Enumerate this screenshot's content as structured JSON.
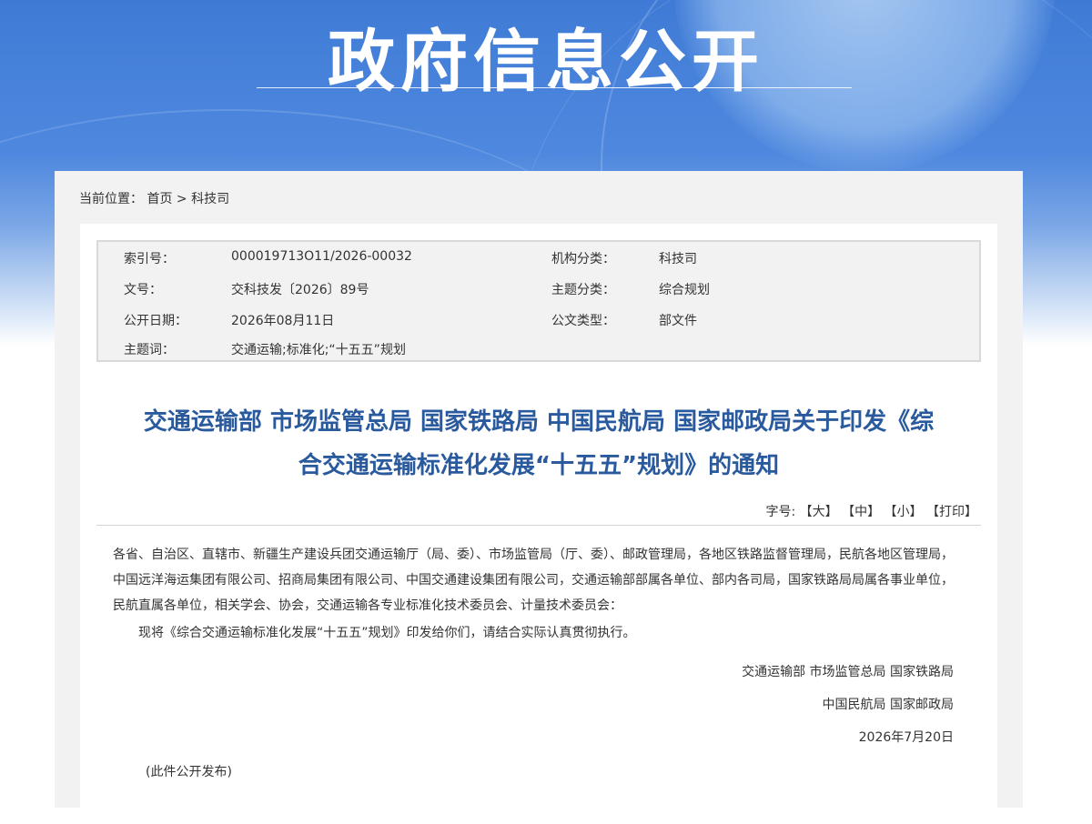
{
  "banner": {
    "title": "政府信息公开"
  },
  "breadcrumb": {
    "label": "当前位置：",
    "home": "首页",
    "sep": ">",
    "current": "科技司"
  },
  "meta": {
    "index_label": "索引号：",
    "index_value": "000019713O11/2026-00032",
    "org_label": "机构分类：",
    "org_value": "科技司",
    "docno_label": "文号：",
    "docno_value": "交科技发〔2026〕89号",
    "topic_label": "主题分类：",
    "topic_value": "综合规划",
    "date_label": "公开日期：",
    "date_value": "2026年08月11日",
    "type_label": "公文类型：",
    "type_value": "部文件",
    "keywords_label": "主题词：",
    "keywords_value": "交通运输;标准化;“十五五”规划"
  },
  "document": {
    "title_line1": "交通运输部 市场监管总局 国家铁路局 中国民航局 国家邮政局关于印发《综",
    "title_line2": "合交通运输标准化发展“十五五”规划》的通知",
    "fontsize_label": "字号:",
    "font_large": "【大】",
    "font_medium": "【中】",
    "font_small": "【小】",
    "print": "【打印】",
    "recipients": "各省、自治区、直辖市、新疆生产建设兵团交通运输厅（局、委）、市场监管局（厅、委）、邮政管理局，各地区铁路监督管理局，民航各地区管理局，中国远洋海运集团有限公司、招商局集团有限公司、中国交通建设集团有限公司，交通运输部部属各单位、部内各司局，国家铁路局局属各事业单位，民航直属各单位，相关学会、协会，交通运输各专业标准化技术委员会、计量技术委员会：",
    "body": "现将《综合交通运输标准化发展“十五五”规划》印发给你们，请结合实际认真贯彻执行。",
    "sign1": "交通运输部 市场监管总局 国家铁路局",
    "sign2": "中国民航局 国家邮政局",
    "sign_date": "2026年7月20日",
    "note": "(此件公开发布)"
  }
}
